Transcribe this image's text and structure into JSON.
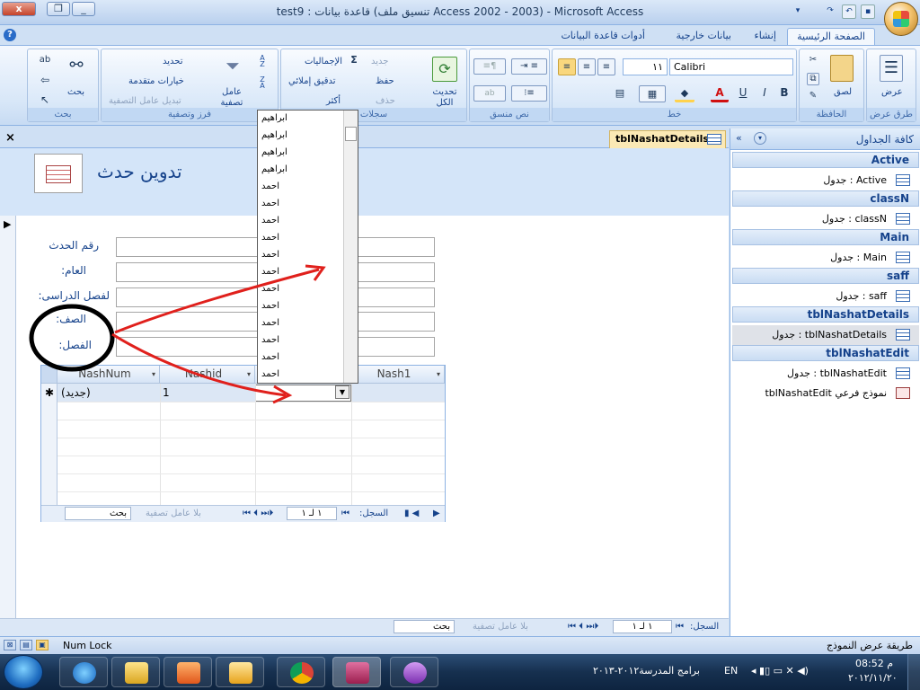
{
  "window": {
    "title": "Microsoft Access - (Access 2002 - 2003 تنسيق ملف) قاعدة بيانات : test9",
    "close_label": "x",
    "restore_label": "❐",
    "minimize_label": "_"
  },
  "tabs": [
    "الصفحة الرئيسية",
    "إنشاء",
    "بيانات خارجية",
    "أدوات قاعدة البيانات"
  ],
  "ribbon": {
    "views": {
      "label": "عرض",
      "group": "طرق عرض"
    },
    "clipboard": {
      "paste": "لصق",
      "group": "الحافظة"
    },
    "font": {
      "name": "Calibri",
      "size": "١١",
      "group": "خط",
      "bold": "B",
      "italic": "I",
      "underline": "U"
    },
    "richtext": {
      "group": "نص منسق"
    },
    "records": {
      "refresh": "تحديث الكل",
      "new": "جديد",
      "save": "حفظ",
      "delete": "حذف",
      "totals": "الإجماليات",
      "spelling": "تدقيق إملائي",
      "more": "أكثر",
      "group": "سجلات"
    },
    "sortfilter": {
      "filter": "عامل تصفية",
      "selection": "تحديد",
      "advanced": "خيارات متقدمة",
      "toggle": "تبديل عامل التصفية",
      "group": "فرز وتصفية"
    },
    "find": {
      "find": "بحث",
      "group": "بحث"
    }
  },
  "nav_pane": {
    "title": "كافة الجداول",
    "groups": [
      {
        "name": "Active",
        "items": [
          {
            "label": "Active : جدول",
            "kind": "table"
          }
        ]
      },
      {
        "name": "classN",
        "items": [
          {
            "label": "classN : جدول",
            "kind": "table"
          }
        ]
      },
      {
        "name": "Main",
        "items": [
          {
            "label": "Main : جدول",
            "kind": "table"
          }
        ]
      },
      {
        "name": "saff",
        "items": [
          {
            "label": "saff : جدول",
            "kind": "table"
          }
        ]
      },
      {
        "name": "tblNashatDetails",
        "items": [
          {
            "label": "tblNashatDetails : جدول",
            "kind": "table",
            "selected": true
          }
        ]
      },
      {
        "name": "tblNashatEdit",
        "items": [
          {
            "label": "tblNashatEdit : جدول",
            "kind": "table"
          },
          {
            "label": "نموذج فرعي tblNashatEdit",
            "kind": "form"
          }
        ]
      }
    ]
  },
  "document": {
    "tab_title": "tblNashatDetails",
    "form_title": "تدوين حدث",
    "fields": [
      "رقم الحدث",
      "العام:",
      "لفصل الدراسى:",
      "الصف:",
      "الفصل:"
    ]
  },
  "subform": {
    "columns": [
      "NashNum",
      "Nashid",
      "",
      "Nash1"
    ],
    "new_row": {
      "marker": "✱",
      "nashnum": "(جديد)",
      "nashid": "1"
    },
    "nav": {
      "label": "السجل:",
      "position": "١ لـ ١",
      "filter": "بلا عامل تصفية",
      "search": "بحث"
    }
  },
  "dropdown_items": [
    "ابراهيم",
    "ابراهيم",
    "ابراهيم",
    "ابراهيم",
    "احمد",
    "احمد",
    "احمد",
    "احمد",
    "احمد",
    "احمد",
    "احمد",
    "احمد",
    "احمد",
    "احمد",
    "احمد",
    "احمد"
  ],
  "form_nav": {
    "label": "السجل:",
    "position": "١ لـ ١",
    "filter": "بلا عامل تصفية",
    "search": "بحث"
  },
  "status": {
    "view": "طريقة عرض النموذج",
    "numlock": "Num Lock"
  },
  "taskbar": {
    "window_title": "برامج المدرسة٢٠١٢-٢٠١٣",
    "lang": "EN",
    "time": "08:52 م",
    "date": "٢٠١٢/١١/٢٠"
  },
  "colors": {
    "annotation": "#e0201c",
    "accent": "#15428b"
  }
}
